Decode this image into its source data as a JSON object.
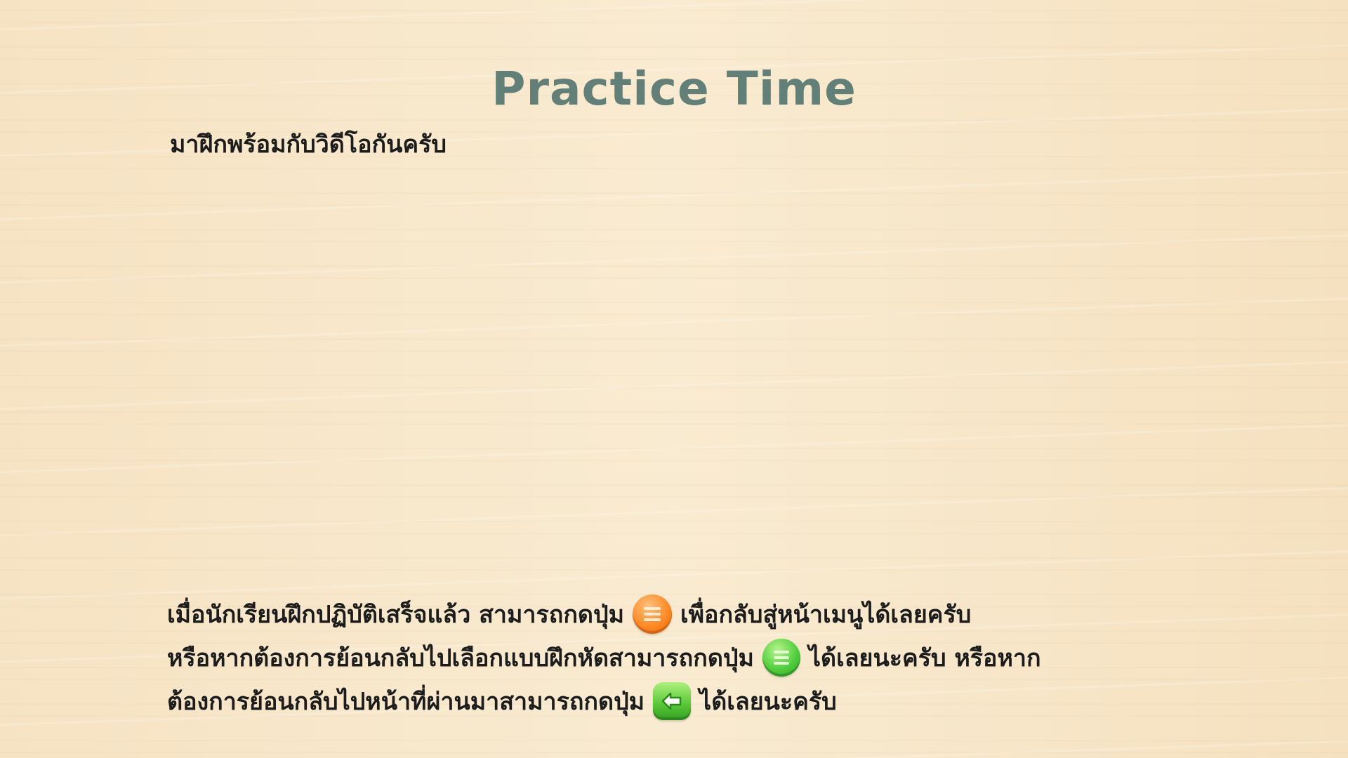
{
  "header": {
    "title": "Practice Time",
    "subtitle": "มาฝึกพร้อมกับวิดีโอกันครับ"
  },
  "instructions": {
    "line1_part1": "เมื่อนักเรียนฝึกปฏิบัติเสร็จแล้ว สามารถกดปุ่ม",
    "line1_part2": "เพื่อกลับสู่หน้าเมนูได้เลยครับ",
    "line2_part1": "หรือหากต้องการย้อนกลับไปเลือกแบบฝึกหัดสามารถกดปุ่ม",
    "line2_part2": "ได้เลยนะครับ หรือหาก",
    "line3_part1": "ต้องการย้อนกลับไปหน้าที่ผ่านมาสามารถกดปุ่ม",
    "line3_part2": "ได้เลยนะครับ"
  },
  "icons": {
    "menu_button": "menu-lines-icon",
    "exercise_menu_button": "menu-lines-icon",
    "back_button": "arrow-left-icon"
  },
  "colors": {
    "title": "#627f78",
    "text": "#1c1c1c",
    "background": "#f7e6c8",
    "orange_button": "#ff8a26",
    "green_button": "#4fcf3c"
  }
}
